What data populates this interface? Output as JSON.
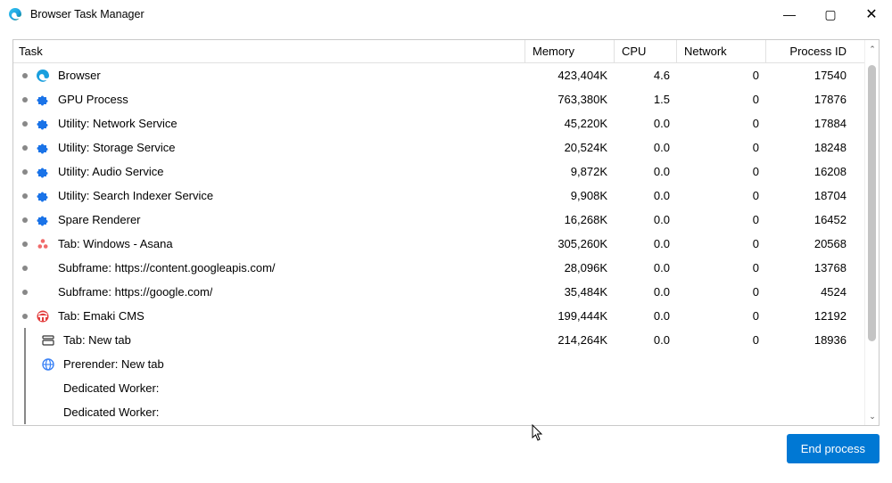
{
  "window": {
    "title": "Browser Task Manager",
    "minimize": "―",
    "maximize": "▢",
    "close": "✕"
  },
  "columns": {
    "task": "Task",
    "memory": "Memory",
    "cpu": "CPU",
    "network": "Network",
    "pid": "Process ID"
  },
  "rows": [
    {
      "bullet": true,
      "group": false,
      "icon": "edge",
      "name": "Browser",
      "memory": "423,404K",
      "cpu": "4.6",
      "network": "0",
      "pid": "17540"
    },
    {
      "bullet": true,
      "group": false,
      "icon": "puzzle",
      "name": "GPU Process",
      "memory": "763,380K",
      "cpu": "1.5",
      "network": "0",
      "pid": "17876"
    },
    {
      "bullet": true,
      "group": false,
      "icon": "puzzle",
      "name": "Utility: Network Service",
      "memory": "45,220K",
      "cpu": "0.0",
      "network": "0",
      "pid": "17884"
    },
    {
      "bullet": true,
      "group": false,
      "icon": "puzzle",
      "name": "Utility: Storage Service",
      "memory": "20,524K",
      "cpu": "0.0",
      "network": "0",
      "pid": "18248"
    },
    {
      "bullet": true,
      "group": false,
      "icon": "puzzle",
      "name": "Utility: Audio Service",
      "memory": "9,872K",
      "cpu": "0.0",
      "network": "0",
      "pid": "16208"
    },
    {
      "bullet": true,
      "group": false,
      "icon": "puzzle",
      "name": "Utility: Search Indexer Service",
      "memory": "9,908K",
      "cpu": "0.0",
      "network": "0",
      "pid": "18704"
    },
    {
      "bullet": true,
      "group": false,
      "icon": "puzzle",
      "name": "Spare Renderer",
      "memory": "16,268K",
      "cpu": "0.0",
      "network": "0",
      "pid": "16452"
    },
    {
      "bullet": true,
      "group": false,
      "icon": "asana",
      "name": "Tab: Windows - Asana",
      "memory": "305,260K",
      "cpu": "0.0",
      "network": "0",
      "pid": "20568"
    },
    {
      "bullet": true,
      "group": false,
      "icon": "",
      "name": "Subframe: https://content.googleapis.com/",
      "memory": "28,096K",
      "cpu": "0.0",
      "network": "0",
      "pid": "13768"
    },
    {
      "bullet": true,
      "group": false,
      "icon": "",
      "name": "Subframe: https://google.com/",
      "memory": "35,484K",
      "cpu": "0.0",
      "network": "0",
      "pid": "4524"
    },
    {
      "bullet": true,
      "group": false,
      "icon": "emaki",
      "name": "Tab: Emaki CMS",
      "memory": "199,444K",
      "cpu": "0.0",
      "network": "0",
      "pid": "12192"
    },
    {
      "bullet": false,
      "group": true,
      "icon": "newtab",
      "name": "Tab: New tab",
      "memory": "214,264K",
      "cpu": "0.0",
      "network": "0",
      "pid": "18936"
    },
    {
      "bullet": false,
      "group": true,
      "icon": "globe",
      "name": "Prerender: New tab",
      "memory": "",
      "cpu": "",
      "network": "",
      "pid": ""
    },
    {
      "bullet": false,
      "group": true,
      "icon": "",
      "name": "Dedicated Worker:",
      "memory": "",
      "cpu": "",
      "network": "",
      "pid": ""
    },
    {
      "bullet": false,
      "group": true,
      "icon": "",
      "name": "Dedicated Worker:",
      "memory": "",
      "cpu": "",
      "network": "",
      "pid": ""
    }
  ],
  "buttons": {
    "end_process": "End process"
  },
  "scroll": {
    "up": "⌃",
    "down": "⌄"
  },
  "icons": {
    "edge_color1": "#36c7f0",
    "edge_color2": "#0f7c4b",
    "puzzle_color": "#1a73e8",
    "asana_color": "#f06a6a",
    "emaki_color": "#e23b3b"
  }
}
